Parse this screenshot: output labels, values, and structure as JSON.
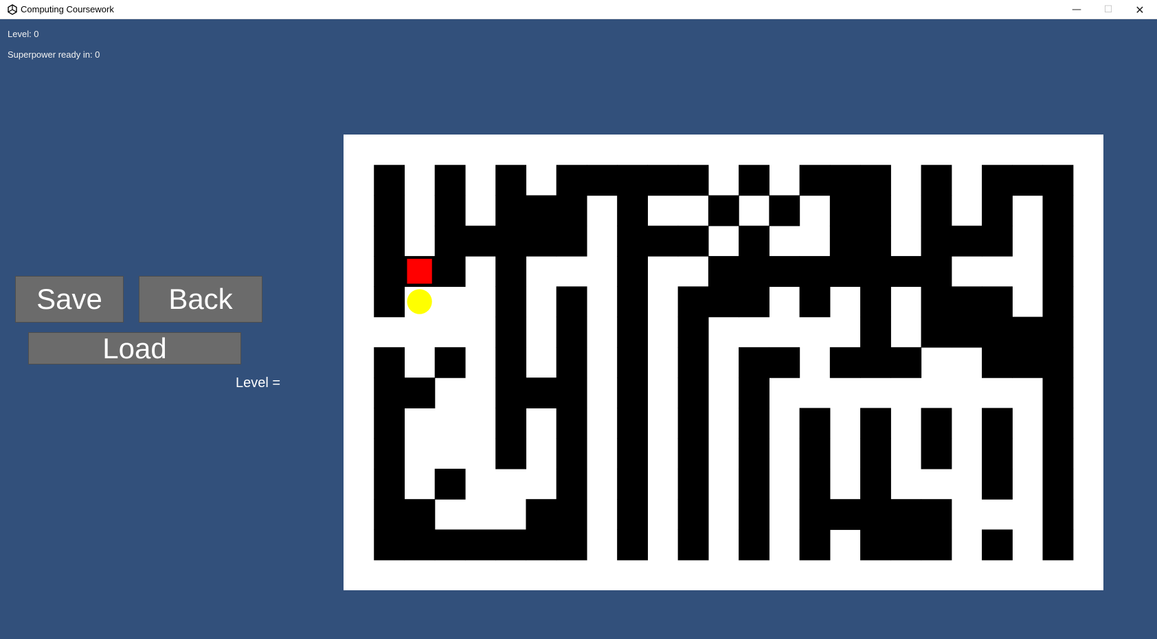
{
  "window": {
    "title": "Computing Coursework",
    "minimize_glyph": "—",
    "maximize_glyph": "☐",
    "close_glyph": "✕",
    "app_icon": "unity-logo-icon"
  },
  "hud": {
    "level_text": "Level: 0",
    "superpower_text": "Superpower ready in: 0"
  },
  "buttons": {
    "save_label": "Save",
    "back_label": "Back",
    "load_label": "Load"
  },
  "level_input": {
    "label": "Level ="
  },
  "maze": {
    "colors": {
      "background": "#ffffff",
      "wall": "#000000",
      "enemy": "#ff0000",
      "player": "#ffff00",
      "page_background": "#32507b"
    },
    "grid": [
      "0000000000000000000000000",
      "0101010111110101110101110",
      "0101011101001010110101010",
      "0101111101110100110111010",
      "0111010001001111111100010",
      "0100010101011101010111010",
      "0000010101010000010111110",
      "0101010101010110111001110",
      "0110011101010100000000010",
      "0100010101010101010101010",
      "0100010101010101010101010",
      "0101000101010101010001010",
      "0110001101010101111100010",
      "0111111101010101011101010",
      "0000000000000000000000000"
    ],
    "enemy_cell": {
      "row": 4,
      "col": 2
    },
    "player_cell": {
      "row": 5,
      "col": 2
    }
  }
}
